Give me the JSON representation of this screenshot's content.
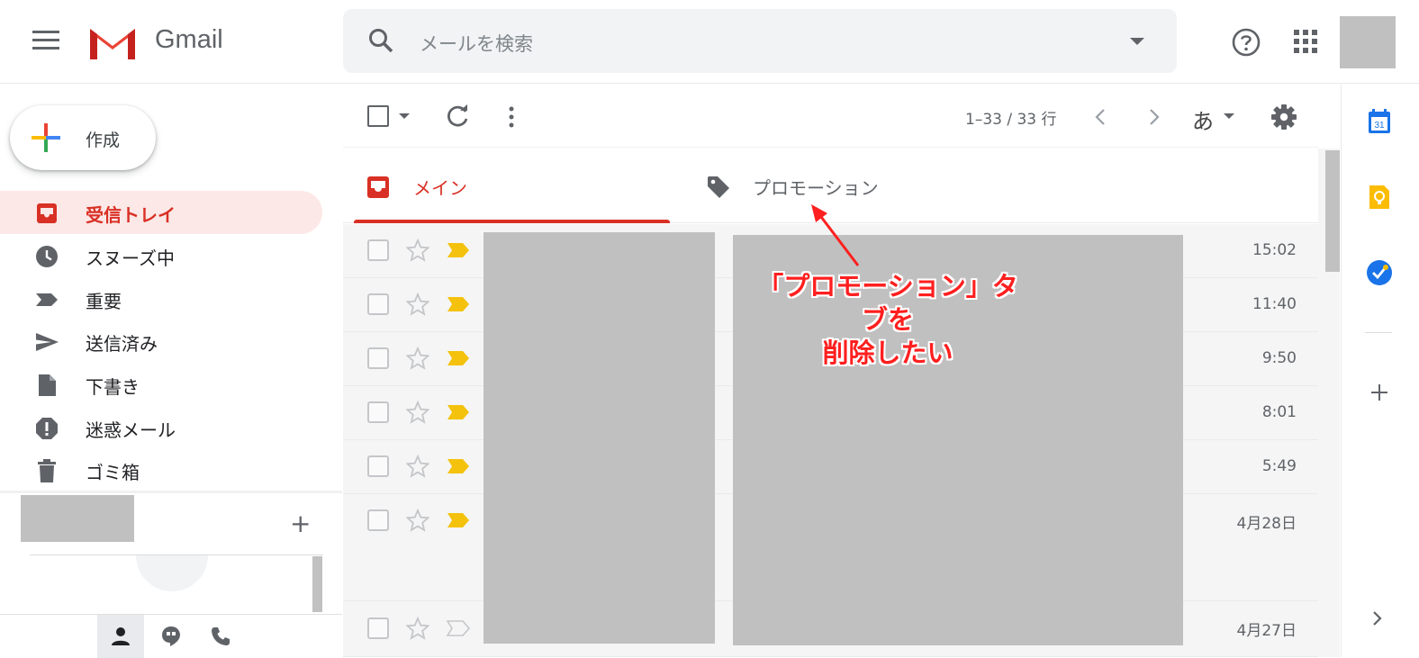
{
  "header": {
    "app_name": "Gmail",
    "search_placeholder": "メールを検索",
    "icons": [
      "menu-icon",
      "gmail-logo",
      "search-icon",
      "dropdown-icon",
      "help-icon",
      "apps-icon"
    ]
  },
  "compose": {
    "label": "作成"
  },
  "sidebar": {
    "items": [
      {
        "label": "受信トレイ",
        "icon": "inbox-icon",
        "active": true
      },
      {
        "label": "スヌーズ中",
        "icon": "clock-icon",
        "active": false
      },
      {
        "label": "重要",
        "icon": "important-icon",
        "active": false
      },
      {
        "label": "送信済み",
        "icon": "send-icon",
        "active": false
      },
      {
        "label": "下書き",
        "icon": "draft-icon",
        "active": false
      },
      {
        "label": "迷惑メール",
        "icon": "spam-icon",
        "active": false
      },
      {
        "label": "ゴミ箱",
        "icon": "trash-icon",
        "active": false
      }
    ],
    "add_label": "+"
  },
  "toolbar": {
    "pager": "1–33 / 33 行",
    "input_tool": "あ"
  },
  "tabs": [
    {
      "label": "メイン",
      "icon": "inbox-tab-icon",
      "active": true
    },
    {
      "label": "プロモーション",
      "icon": "tag-icon",
      "active": false
    }
  ],
  "emails": [
    {
      "time": "15:02",
      "important": true
    },
    {
      "time": "11:40",
      "important": true
    },
    {
      "time": "9:50",
      "important": true
    },
    {
      "time": "8:01",
      "important": true
    },
    {
      "time": "5:49",
      "important": true
    },
    {
      "time": "4月28日",
      "important": true
    },
    {
      "time": "4月27日",
      "important": false
    }
  ],
  "annotation": {
    "line1": "「プロモーション」タブを",
    "line2": "削除したい"
  },
  "right_panel": {
    "calendar_day": "31",
    "icons": [
      "calendar-icon",
      "keep-icon",
      "tasks-icon",
      "add-addon-icon",
      "expand-icon"
    ]
  },
  "colors": {
    "accent_red": "#d93025",
    "annotation_red": "#ff1f1f",
    "important_yellow": "#f4c20d",
    "redaction_gray": "#c0c0c0"
  }
}
